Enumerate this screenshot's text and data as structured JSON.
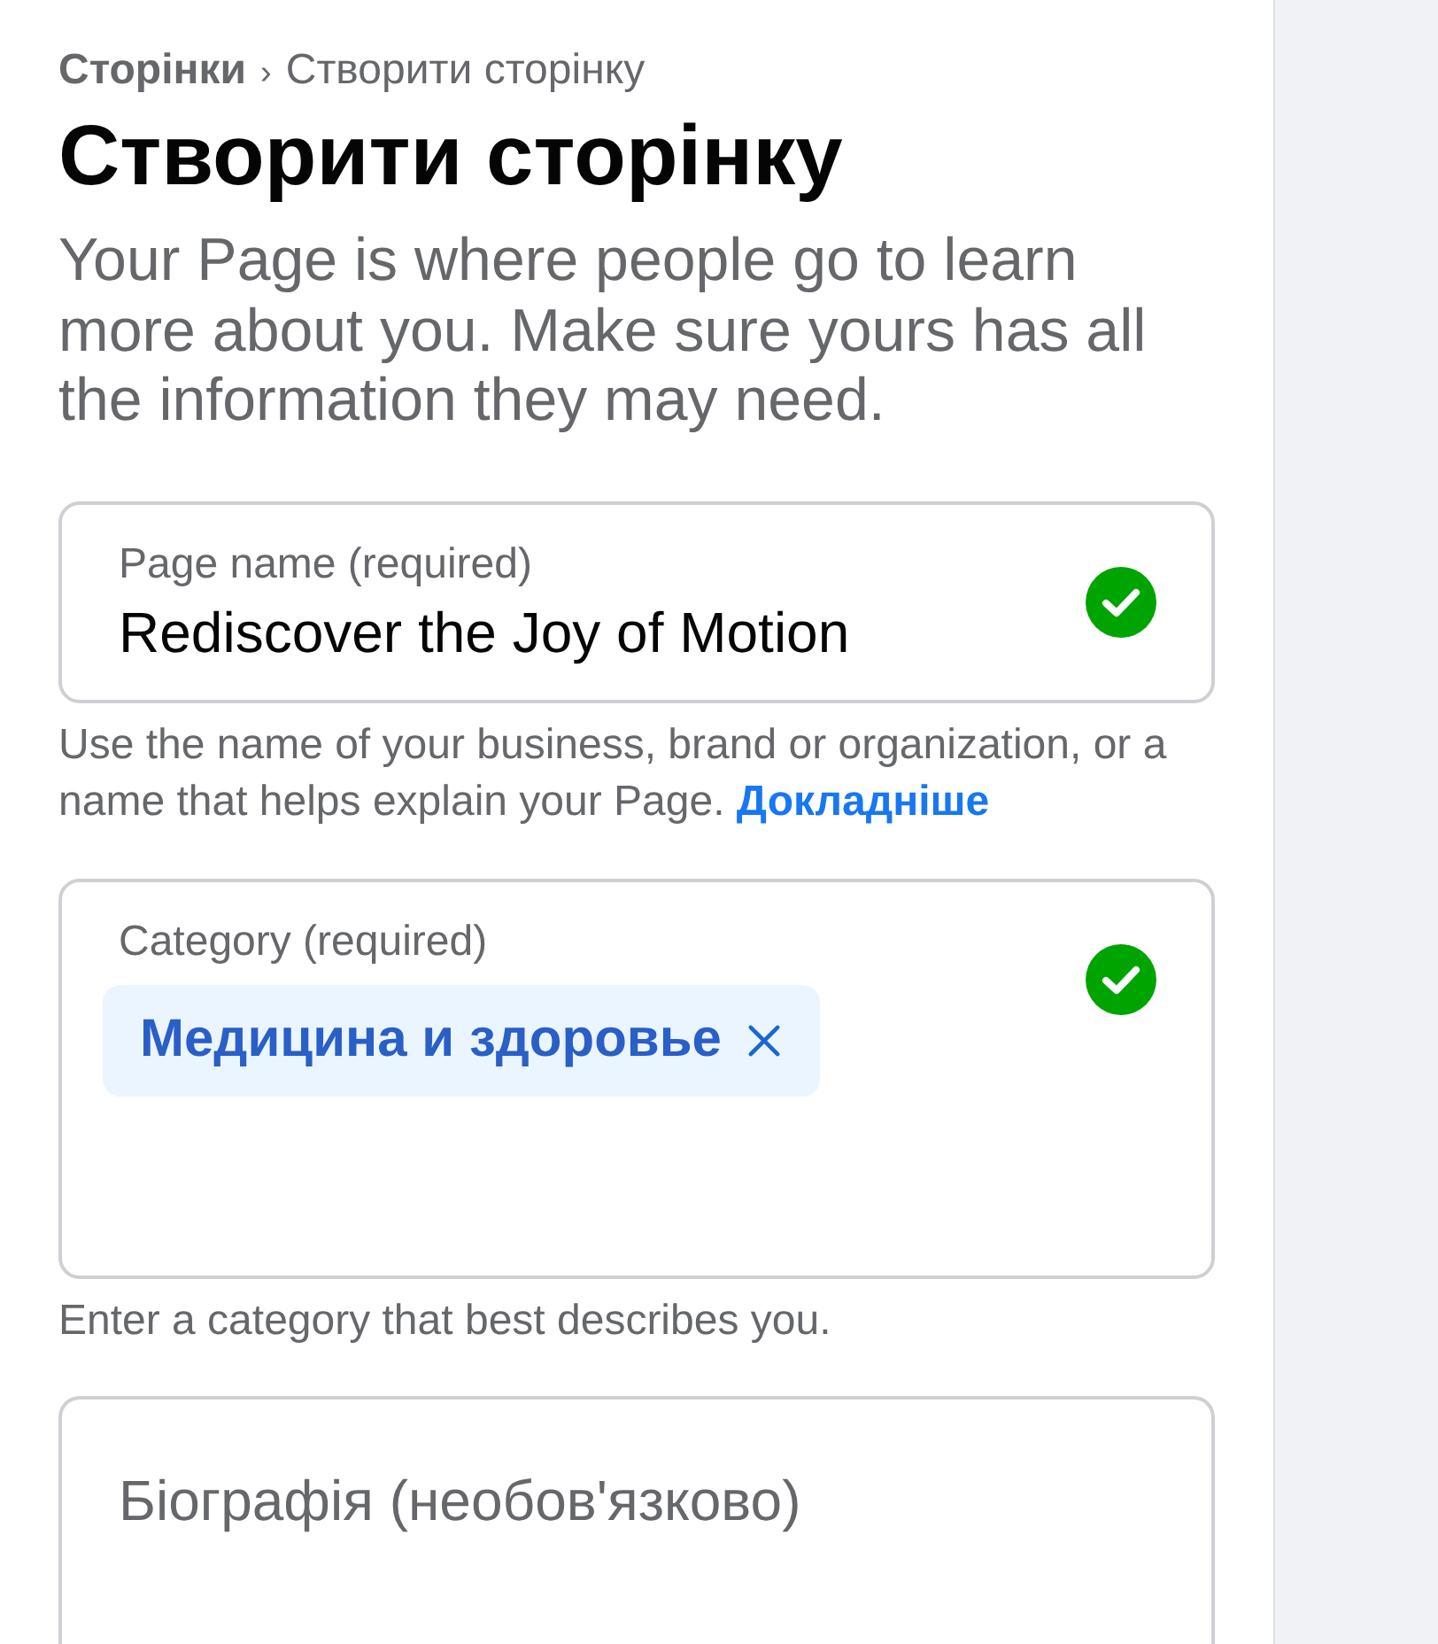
{
  "breadcrumb": {
    "parent": "Сторінки",
    "separator": "›",
    "current": "Створити сторінку"
  },
  "title": "Створити сторінку",
  "description": "Your Page is where people go to learn more about you. Make sure yours has all the information they may need.",
  "fields": [
    {
      "kind": "text",
      "label": "Page name (required)",
      "value": "Rediscover the Joy of Motion",
      "valid": true,
      "help": "Use the name of your business, brand or organization, or a name that helps explain your Page.",
      "help_link": "Докладніше"
    },
    {
      "kind": "tags",
      "label": "Category (required)",
      "tags": [
        {
          "label": "Медицина и здоровье"
        }
      ],
      "valid": true,
      "help": "Enter a category that best describes you."
    },
    {
      "kind": "textarea",
      "placeholder": "Біографія (необов'язково)",
      "valid": false
    }
  ]
}
